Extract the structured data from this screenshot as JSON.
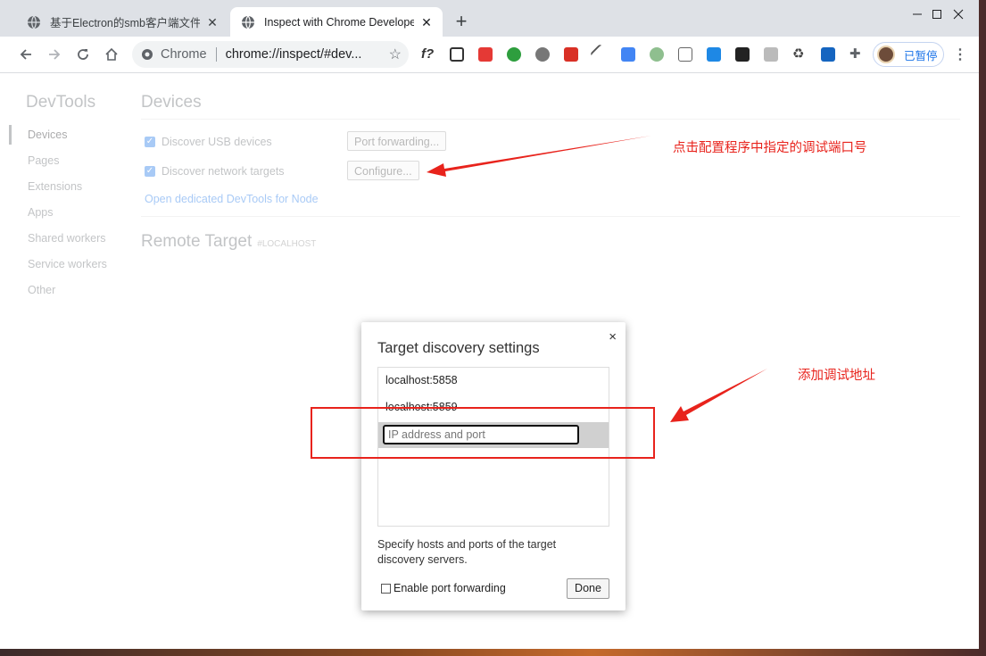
{
  "tabs": [
    {
      "title": "基于Electron的smb客户端文件上",
      "active": false
    },
    {
      "title": "Inspect with Chrome Develope",
      "active": true
    }
  ],
  "omnibox": {
    "chip": "Chrome",
    "url": "chrome://inspect/#dev..."
  },
  "profile": {
    "label": "已暂停"
  },
  "devtools": {
    "title": "DevTools",
    "sidebar": [
      "Devices",
      "Pages",
      "Extensions",
      "Apps",
      "Shared workers",
      "Service workers",
      "Other"
    ],
    "devices_heading": "Devices",
    "discover_usb": "Discover USB devices",
    "discover_network": "Discover network targets",
    "port_forwarding_button": "Port forwarding...",
    "configure_button": "Configure...",
    "node_link": "Open dedicated DevTools for Node",
    "remote_target": "Remote Target",
    "remote_target_sub": "#LOCALHOST"
  },
  "dialog": {
    "title": "Target discovery settings",
    "close": "×",
    "items": [
      "localhost:5858",
      "localhost:5859"
    ],
    "input_placeholder": "IP address and port",
    "description": "Specify hosts and ports of the target discovery servers.",
    "enable_port_forwarding": "Enable port forwarding",
    "done_button": "Done"
  },
  "annotations": {
    "configure_note": "点击配置程序中指定的调试端口号",
    "add_note": "添加调试地址",
    "color": "#e8231c"
  }
}
